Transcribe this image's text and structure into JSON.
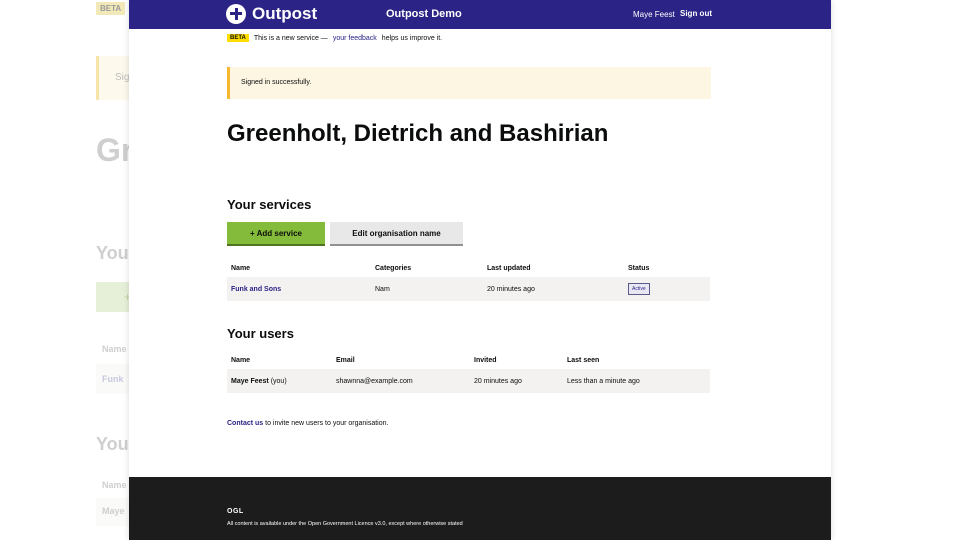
{
  "background": {
    "beta_label": "BETA",
    "banner_text": "Sig",
    "heading": "Gr",
    "services_heading": "You",
    "add_button_glyph": "+",
    "table_header_name": "Name",
    "row_name": "Funk",
    "users_heading": "You",
    "users_header_name": "Name",
    "users_row_name": "Maye"
  },
  "header": {
    "logo_text": "Outpost",
    "service_name": "Outpost Demo",
    "user_name": "Maye Feest",
    "sign_out": "Sign out"
  },
  "phase_banner": {
    "tag": "BETA",
    "text_before": "This is a new service —",
    "link": "your feedback",
    "text_after": "helps us improve it."
  },
  "notice": {
    "text": "Signed in successfully."
  },
  "organisation": {
    "name": "Greenholt, Dietrich and Bashirian"
  },
  "services": {
    "heading": "Your services",
    "add_button": "+ Add service",
    "edit_button": "Edit organisation name",
    "columns": [
      "Name",
      "Categories",
      "Last updated",
      "Status"
    ],
    "rows": [
      {
        "name": "Funk and Sons",
        "categories": "Nam",
        "last_updated": "20 minutes ago",
        "status": "Active"
      }
    ]
  },
  "users": {
    "heading": "Your users",
    "columns": [
      "Name",
      "Email",
      "Invited",
      "Last seen"
    ],
    "rows": [
      {
        "name": "Maye Feest",
        "you": "(you)",
        "email": "shawnna@example.com",
        "invited": "20 minutes ago",
        "last_seen": "Less than a minute ago"
      }
    ]
  },
  "contact": {
    "link": "Contact us",
    "text": "to invite new users to your organisation."
  },
  "footer": {
    "ogl": "OGL",
    "licence_before": "All content is available under the",
    "licence_link": "Open Government Licence v3.0",
    "licence_after": ", except where otherwise stated"
  },
  "colors": {
    "header_bg": "#2b2385",
    "accent_green": "#84bb3a",
    "notice_border": "#f5b82e",
    "footer_bg": "#1c1c1c"
  }
}
